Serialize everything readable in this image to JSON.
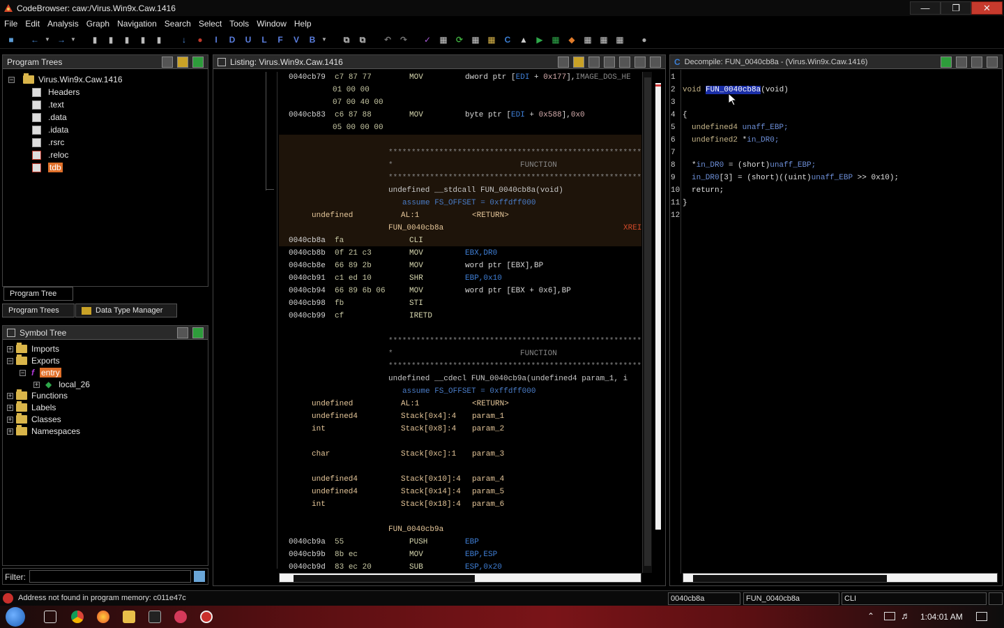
{
  "window": {
    "title": "CodeBrowser: caw:/Virus.Win9x.Caw.1416"
  },
  "menu": [
    "File",
    "Edit",
    "Analysis",
    "Graph",
    "Navigation",
    "Search",
    "Select",
    "Tools",
    "Window",
    "Help"
  ],
  "program_trees": {
    "header": "Program Trees",
    "root": "Virus.Win9x.Caw.1416",
    "items": [
      "Headers",
      ".text",
      ".data",
      ".idata",
      ".rsrc",
      ".reloc",
      "tdb"
    ],
    "tab_label": "Program Tree",
    "bottom_tabs": [
      "Program Trees",
      "Data Type Manager"
    ]
  },
  "symbol_tree": {
    "header": "Symbol Tree",
    "items": [
      "Imports",
      "Exports",
      "entry",
      "local_26",
      "Functions",
      "Labels",
      "Classes",
      "Namespaces"
    ]
  },
  "filter": {
    "label": "Filter:"
  },
  "listing": {
    "header": "Listing:  Virus.Win9x.Caw.1416",
    "lines": [
      {
        "addr": "0040cb79",
        "bytes": "c7 87 77",
        "mnem": "MOV",
        "ops": "dword ptr [EDI + 0x177],IMAGE_DOS_HE"
      },
      {
        "addr": "",
        "bytes": "01 00 00",
        "mnem": "",
        "ops": ""
      },
      {
        "addr": "",
        "bytes": "07 00 40 00",
        "mnem": "",
        "ops": ""
      },
      {
        "addr": "0040cb83",
        "bytes": "c6 87 88",
        "mnem": "MOV",
        "ops": "byte ptr [EDI + 0x588],0x0"
      },
      {
        "addr": "",
        "bytes": "05 00 00 00",
        "mnem": "",
        "ops": ""
      }
    ],
    "func1": {
      "stars": "**************************************************************",
      "function_label": "FUNCTION",
      "signature": "undefined __stdcall FUN_0040cb8a(void)",
      "assume": "assume FS_OFFSET = 0xffdff000",
      "ret_type": "undefined",
      "ret_loc": "AL:1",
      "ret_name": "<RETURN>",
      "label": "FUN_0040cb8a",
      "xref": "XREI",
      "instrs": [
        {
          "addr": "0040cb8a",
          "bytes": "fa",
          "mnem": "CLI",
          "ops": ""
        },
        {
          "addr": "0040cb8b",
          "bytes": "0f 21 c3",
          "mnem": "MOV",
          "ops": "EBX,DR0"
        },
        {
          "addr": "0040cb8e",
          "bytes": "66 89 2b",
          "mnem": "MOV",
          "ops": "word ptr [EBX],BP"
        },
        {
          "addr": "0040cb91",
          "bytes": "c1 ed 10",
          "mnem": "SHR",
          "ops": "EBP,0x10"
        },
        {
          "addr": "0040cb94",
          "bytes": "66 89 6b 06",
          "mnem": "MOV",
          "ops": "word ptr [EBX + 0x6],BP"
        },
        {
          "addr": "0040cb98",
          "bytes": "fb",
          "mnem": "STI",
          "ops": ""
        },
        {
          "addr": "0040cb99",
          "bytes": "cf",
          "mnem": "IRETD",
          "ops": ""
        }
      ]
    },
    "func2": {
      "stars": "**************************************************************",
      "function_label": "FUNCTION",
      "signature": "undefined __cdecl FUN_0040cb9a(undefined4 param_1, i",
      "assume": "assume FS_OFFSET = 0xffdff000",
      "params": [
        {
          "type": "undefined",
          "loc": "AL:1",
          "name": "<RETURN>"
        },
        {
          "type": "undefined4",
          "loc": "Stack[0x4]:4",
          "name": "param_1"
        },
        {
          "type": "int",
          "loc": "Stack[0x8]:4",
          "name": "param_2"
        },
        {
          "type": "char",
          "loc": "Stack[0xc]:1",
          "name": "param_3"
        },
        {
          "type": "undefined4",
          "loc": "Stack[0x10]:4",
          "name": "param_4"
        },
        {
          "type": "undefined4",
          "loc": "Stack[0x14]:4",
          "name": "param_5"
        },
        {
          "type": "int",
          "loc": "Stack[0x18]:4",
          "name": "param_6"
        }
      ],
      "label": "FUN_0040cb9a",
      "instrs": [
        {
          "addr": "0040cb9a",
          "bytes": "55",
          "mnem": "PUSH",
          "ops": "EBP"
        },
        {
          "addr": "0040cb9b",
          "bytes": "8b ec",
          "mnem": "MOV",
          "ops": "EBP,ESP"
        },
        {
          "addr": "0040cb9d",
          "bytes": "83 ec 20",
          "mnem": "SUB",
          "ops": "ESP,0x20"
        }
      ]
    }
  },
  "decompile": {
    "header": "Decompile: FUN_0040cb8a - (Virus.Win9x.Caw.1416)",
    "line_numbers": [
      "1",
      "2",
      "3",
      "4",
      "5",
      "6",
      "7",
      "8",
      "9",
      "10",
      "11",
      "12"
    ],
    "l2_type": "void",
    "l2_fn": "FUN_0040cb8a",
    "l2_args": "(void)",
    "l4": "{",
    "l5_type": "undefined4",
    "l5_var": "unaff_EBP;",
    "l6_type": "undefined2",
    "l6_ptr": "*",
    "l6_var": "in_DR0;",
    "l8_star": "*",
    "l8_var": "in_DR0",
    "l8_eq": " = (short)",
    "l8_rhs": "unaff_EBP;",
    "l9_var": "in_DR0",
    "l9_idx": "[3] = (short)((uint)",
    "l9_rhs": "unaff_EBP",
    "l9_rest": " >> 0x10);",
    "l10": "return;",
    "l11": "}"
  },
  "status": {
    "message": "Address not found in program memory: c011e47c",
    "addr": "0040cb8a",
    "func": "FUN_0040cb8a",
    "instr": "CLI"
  },
  "taskbar": {
    "time": "1:04:01 AM"
  }
}
